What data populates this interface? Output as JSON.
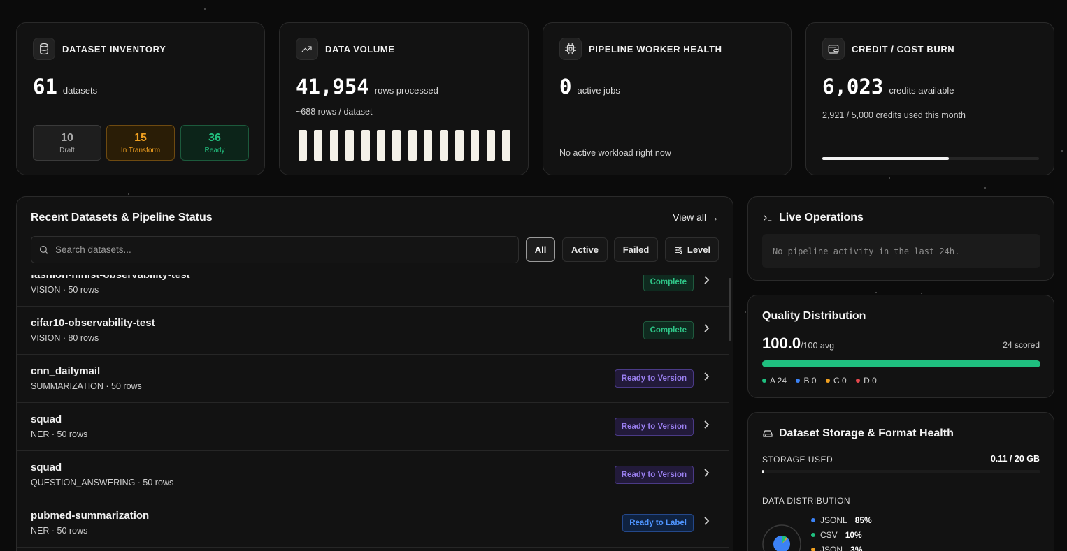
{
  "colors": {
    "accent_green": "#1fbf7f",
    "amber": "#f0a020",
    "purple": "#9a7ff0",
    "blue": "#4f95ff",
    "red": "#e5484d"
  },
  "kpis": {
    "inventory": {
      "icon": "database-icon",
      "title": "DATASET INVENTORY",
      "value": "61",
      "unit": "datasets",
      "draft": {
        "count": "10",
        "label": "Draft"
      },
      "transform": {
        "count": "15",
        "label": "In Transform"
      },
      "ready": {
        "count": "36",
        "label": "Ready"
      }
    },
    "volume": {
      "icon": "trending-up-icon",
      "title": "DATA VOLUME",
      "value": "41,954",
      "unit": "rows processed",
      "sub": "~688 rows / dataset"
    },
    "workers": {
      "icon": "cpu-icon",
      "title": "PIPELINE WORKER HEALTH",
      "value": "0",
      "unit": "active jobs",
      "sub": "No active workload right now"
    },
    "credits": {
      "icon": "wallet-icon",
      "title": "CREDIT / COST BURN",
      "value": "6,023",
      "unit": "credits available",
      "sub": "2,921 / 5,000 credits used this month",
      "used_fraction": 0.584
    }
  },
  "recent": {
    "title": "Recent Datasets & Pipeline Status",
    "view_all": "View all →",
    "search_placeholder": "Search datasets...",
    "filters": {
      "all": "All",
      "active": "Active",
      "failed": "Failed",
      "level": "Level"
    },
    "rows": [
      {
        "name": "fashion-mnist-observability-test",
        "meta": "VISION · 50 rows",
        "status": "Complete"
      },
      {
        "name": "cifar10-observability-test",
        "meta": "VISION · 80 rows",
        "status": "Complete"
      },
      {
        "name": "cnn_dailymail",
        "meta": "SUMMARIZATION · 50 rows",
        "status": "Ready to Version"
      },
      {
        "name": "squad",
        "meta": "NER · 50 rows",
        "status": "Ready to Version"
      },
      {
        "name": "squad",
        "meta": "QUESTION_ANSWERING · 50 rows",
        "status": "Ready to Version"
      },
      {
        "name": "pubmed-summarization",
        "meta": "NER · 50 rows",
        "status": "Ready to Label"
      }
    ]
  },
  "live_ops": {
    "title": "Live Operations",
    "empty": "No pipeline activity in the last 24h."
  },
  "quality": {
    "title": "Quality Distribution",
    "value": "100.0",
    "unit": "/100 avg",
    "scored": "24 scored",
    "legend": [
      {
        "label": "A 24",
        "color": "#1fbf7f"
      },
      {
        "label": "B 0",
        "color": "#3b82f6"
      },
      {
        "label": "C 0",
        "color": "#f0a020"
      },
      {
        "label": "D 0",
        "color": "#e5484d"
      }
    ]
  },
  "storage": {
    "title": "Dataset Storage & Format Health",
    "used_label": "STORAGE USED",
    "used_value": "0.11 / 20 GB",
    "used_fraction": 0.0055,
    "dist_label": "DATA DISTRIBUTION",
    "formats": [
      {
        "name": "JSONL",
        "pct": "85%",
        "color": "#3b82f6"
      },
      {
        "name": "CSV",
        "pct": "10%",
        "color": "#1fbf7f"
      },
      {
        "name": "JSON",
        "pct": "3%",
        "color": "#f0a020"
      }
    ]
  }
}
